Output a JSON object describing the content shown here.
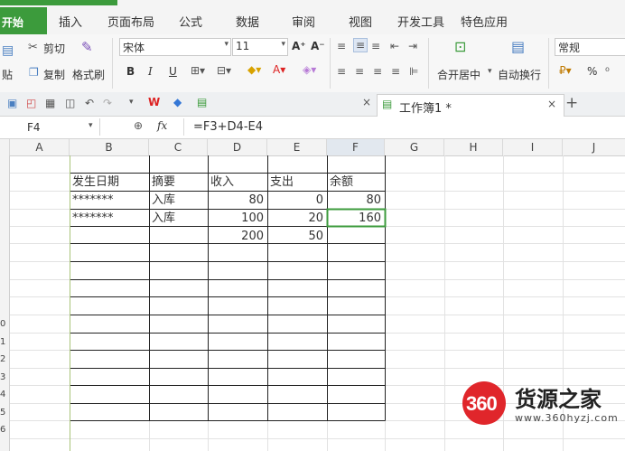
{
  "ribbon_tabs": [
    "开始",
    "插入",
    "页面布局",
    "公式",
    "数据",
    "审阅",
    "视图",
    "开发工具",
    "特色应用"
  ],
  "clipboard": {
    "cut": "剪切",
    "paste": "贴",
    "copy": "复制",
    "format_painter": "格式刷"
  },
  "font": {
    "name": "宋体",
    "size": "11",
    "bold": "B",
    "italic": "I",
    "underline": "U",
    "grow": "A⁺",
    "shrink": "A⁻"
  },
  "alignment": {
    "merge_center": "合开居中",
    "wrap_text": "自动换行"
  },
  "number_format": {
    "value": "常规",
    "percent": "%"
  },
  "document_tab": {
    "name": "工作簿1 *",
    "close": "×"
  },
  "new_tab": "+",
  "other_tab_close": "×",
  "formula_bar": {
    "cell_ref": "F4",
    "fx": "fx",
    "formula": "=F3+D4-E4"
  },
  "columns": [
    "A",
    "B",
    "C",
    "D",
    "E",
    "F",
    "G",
    "H",
    "I",
    "J"
  ],
  "row_labels": [
    "",
    "",
    "",
    "",
    "",
    "",
    "",
    "",
    "0",
    "1",
    "2",
    "3",
    "4",
    "5",
    "6"
  ],
  "table": {
    "headers": [
      "发生日期",
      "摘要",
      "收入",
      "支出",
      "余额"
    ],
    "rows": [
      [
        "*******",
        "入库",
        "80",
        "0",
        "80"
      ],
      [
        "*******",
        "入库",
        "100",
        "20",
        "160"
      ],
      [
        "",
        "",
        "200",
        "50",
        ""
      ]
    ]
  },
  "watermark": {
    "logo": "360",
    "site": "货源之家",
    "url": "www.360hyzj.com"
  }
}
